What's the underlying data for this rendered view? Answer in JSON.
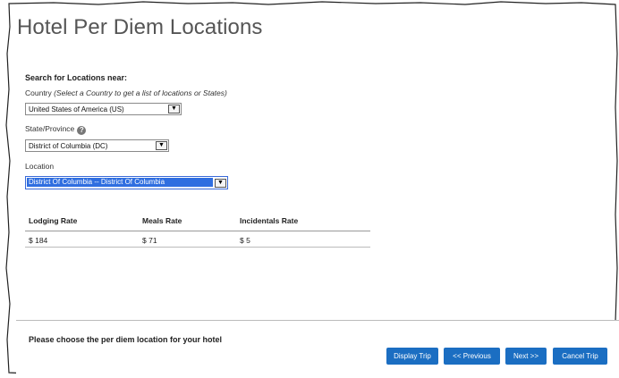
{
  "page": {
    "title": "Hotel Per Diem Locations",
    "section_heading": "Search for Locations near:"
  },
  "country": {
    "label": "Country",
    "hint": "(Select a Country to get a list of locations or States)",
    "selected": "United States of America (US)"
  },
  "state": {
    "label": "State/Province",
    "help_icon": "help-icon",
    "selected": "District of Columbia (DC)"
  },
  "location": {
    "label": "Location",
    "selected": "District Of Columbia -- District Of Columbia"
  },
  "rates": {
    "columns": [
      "Lodging Rate",
      "Meals Rate",
      "Incidentals Rate"
    ],
    "values": [
      "$ 184",
      "$ 71",
      "$ 5"
    ]
  },
  "footer": {
    "message": "Please choose the per diem location for your hotel",
    "buttons": [
      "Display Trip",
      "<< Previous",
      "Next >>",
      "Cancel Trip"
    ]
  },
  "colors": {
    "button_blue": "#1b6ec2",
    "selection_blue": "#2f6ee0"
  }
}
